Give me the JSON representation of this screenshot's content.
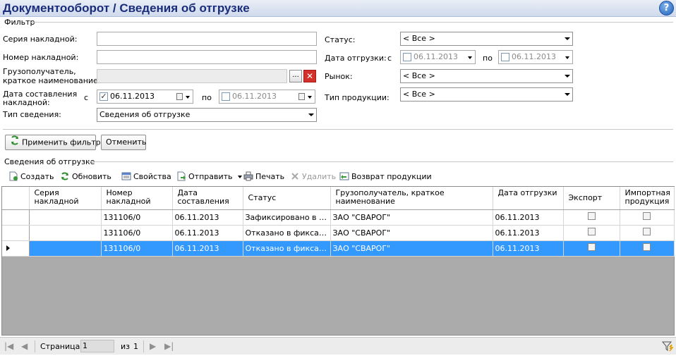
{
  "title": "Документооборот  / Сведения об отгрузке",
  "help_icon_text": "?",
  "filter": {
    "group_label": "Фильтр",
    "series_label": "Серия накладной:",
    "number_label": "Номер накладной:",
    "consignee_label_1": "Грузополучатель,",
    "consignee_label_2": "краткое наименование:",
    "consignee_browse": "...",
    "consignee_clear": "✕",
    "compose_date_label_1": "Дата составления",
    "compose_date_label_2": "накладной:",
    "from_label": "с",
    "to_label": "по",
    "compose_from": "06.11.2013",
    "compose_to": "06.11.2013",
    "info_type_label": "Тип сведения:",
    "info_type_value": "Сведения об отгрузке",
    "status_label": "Статус:",
    "status_value": "< Все >",
    "ship_date_label": "Дата отгрузки:",
    "ship_from_label": "с",
    "ship_to_label": "по",
    "ship_from": "06.11.2013",
    "ship_to": "06.11.2013",
    "market_label": "Рынок:",
    "market_value": "< Все >",
    "product_type_label": "Тип продукции:",
    "product_type_value": "< Все >",
    "apply_button": "Применить фильтр",
    "cancel_button": "Отменить"
  },
  "section_label": "Сведения об отгрузке",
  "toolbar": {
    "create": "Создать",
    "refresh": "Обновить",
    "properties": "Свойства",
    "send": "Отправить",
    "print": "Печать",
    "delete": "Удалить",
    "return": "Возврат продукции"
  },
  "grid": {
    "columns": [
      "Серия накладной",
      "Номер накладной",
      "Дата составления",
      "Статус",
      "Грузополучатель, краткое наименование",
      "Дата отгрузки",
      "Экспорт",
      "Импортная продукция"
    ],
    "rows": [
      {
        "series": "",
        "number": "131106/0",
        "compose_date": "06.11.2013",
        "status": "Зафиксировано в ЕГ...",
        "consignee": "ЗАО \"СВАРОГ\"",
        "ship_date": "06.11.2013"
      },
      {
        "series": "",
        "number": "131106/0",
        "compose_date": "06.11.2013",
        "status": "Отказано в фиксации",
        "consignee": "ЗАО \"СВАРОГ\"",
        "ship_date": "06.11.2013"
      },
      {
        "series": "",
        "number": "131106/0",
        "compose_date": "06.11.2013",
        "status": "Отказано в фиксации",
        "consignee": "ЗАО \"СВАРОГ\"",
        "ship_date": "06.11.2013"
      }
    ]
  },
  "pager": {
    "page_label": "Страница",
    "page_value": "1",
    "of_label": "из",
    "total": "1"
  }
}
